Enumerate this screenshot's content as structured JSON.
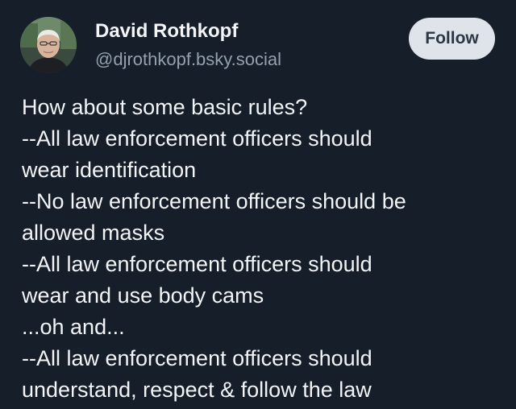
{
  "post": {
    "author": {
      "display_name": "David Rothkopf",
      "handle": "@djrothkopf.bsky.social",
      "avatar_icon": "person-avatar-icon"
    },
    "follow_label": "Follow",
    "lines": [
      "How about some basic rules?",
      "--All law enforcement officers should",
      "wear identification",
      "--No law enforcement officers should be",
      "allowed masks",
      "--All law enforcement officers should",
      "wear and use body cams",
      "...oh and...",
      "--All law enforcement officers should",
      "understand, respect & follow the law"
    ]
  },
  "colors": {
    "background": "#151e29",
    "text": "#f2f4f6",
    "handle": "#94a0ae",
    "button_bg": "#dfe4ea",
    "button_text": "#2b3644"
  }
}
